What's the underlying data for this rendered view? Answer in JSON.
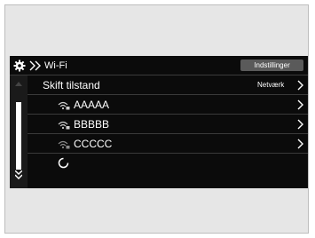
{
  "header": {
    "title": "Wi-Fi",
    "settings_button": "Indstillinger",
    "icon": "gear-icon"
  },
  "toggle_row": {
    "label": "Skift tilstand",
    "value": "Netværk"
  },
  "networks": [
    {
      "name": "AAAAA",
      "icon": "wifi-lock-icon"
    },
    {
      "name": "BBBBB",
      "icon": "wifi-lock-icon"
    },
    {
      "name": "CCCCC",
      "icon": "wifi-lock-icon"
    }
  ],
  "loading_icon": "loading-spinner-icon",
  "colors": {
    "screen_bg": "#0b0b0b",
    "text": "#ffffff",
    "button_bg": "#5a5a5a",
    "divider": "#3a3a3a",
    "frame_bg": "#e6e6e6"
  }
}
